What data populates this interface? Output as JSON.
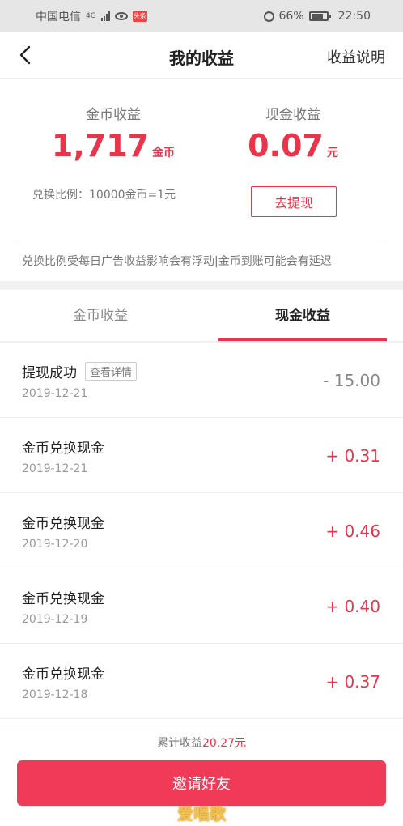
{
  "status_bar": {
    "carrier": "中国电信",
    "network": "4G",
    "app_badge": "头条",
    "battery": "66%",
    "time": "22:50"
  },
  "nav": {
    "back_icon": "chevron-left-icon",
    "title": "我的收益",
    "right_link": "收益说明"
  },
  "summary": {
    "coin_label": "金币收益",
    "coin_value": "1,717",
    "coin_unit": "金币",
    "cash_label": "现金收益",
    "cash_value": "0.07",
    "cash_unit": "元",
    "rate_text": "兑换比例：10000金币=1元",
    "withdraw_label": "去提现",
    "notice": "兑换比例受每日广告收益影响会有浮动|金币到账可能会有延迟"
  },
  "tabs": [
    {
      "label": "金币收益",
      "active": false
    },
    {
      "label": "现金收益",
      "active": true
    }
  ],
  "records": [
    {
      "title": "提现成功",
      "tag": "查看详情",
      "date": "2019-12-21",
      "amount": "- 15.00"
    },
    {
      "title": "金币兑换现金",
      "date": "2019-12-21",
      "amount": "+ 0.31"
    },
    {
      "title": "金币兑换现金",
      "date": "2019-12-20",
      "amount": "+ 0.46"
    },
    {
      "title": "金币兑换现金",
      "date": "2019-12-19",
      "amount": "+ 0.40"
    },
    {
      "title": "金币兑换现金",
      "date": "2019-12-18",
      "amount": "+ 0.37"
    }
  ],
  "footer": {
    "total_label": "累计收益",
    "total_value": "20.27元",
    "invite_label": "邀请好友",
    "watermark": "爱唱歌"
  },
  "colors": {
    "accent": "#e9344b",
    "invite_button": "#f03a57"
  }
}
